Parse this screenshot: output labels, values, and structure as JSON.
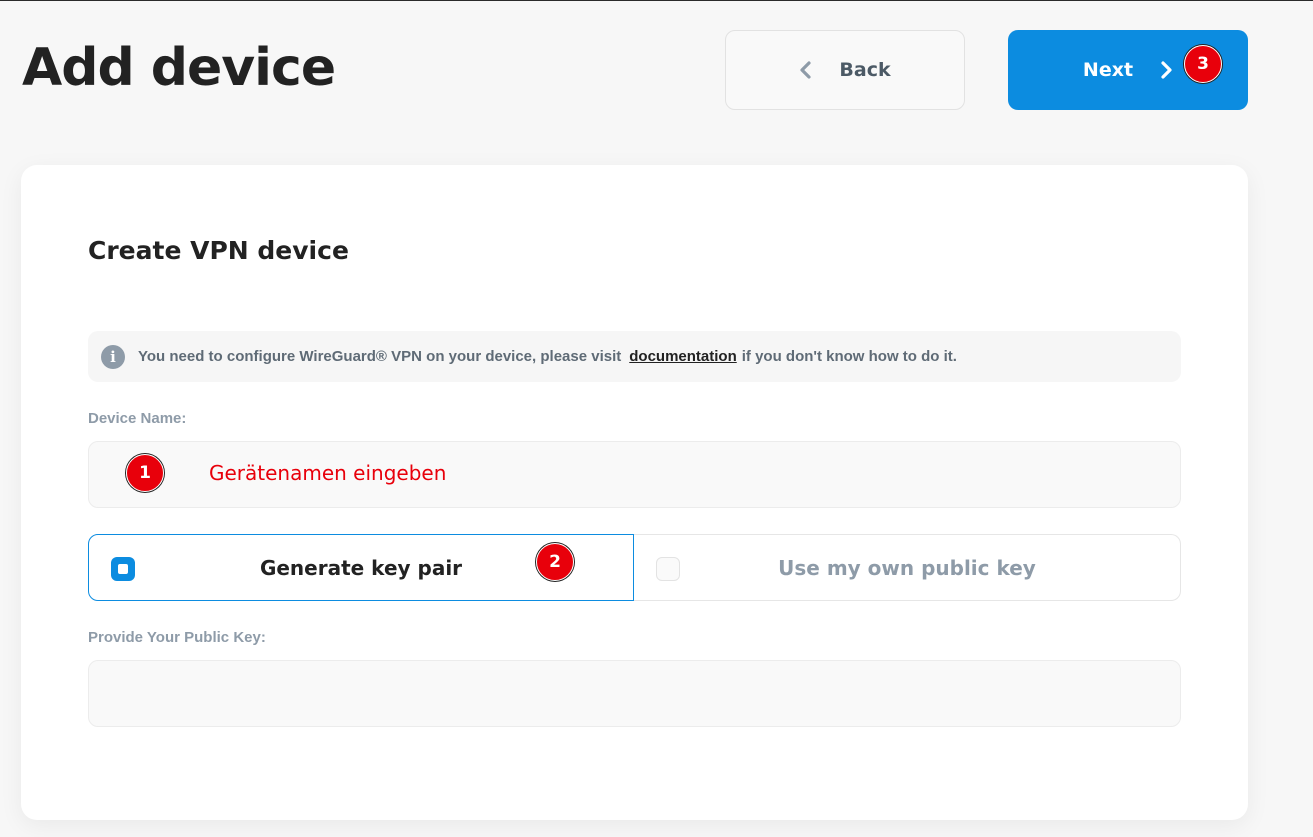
{
  "header": {
    "title": "Add device",
    "back_label": "Back",
    "next_label": "Next"
  },
  "card": {
    "title": "Create VPN device",
    "info": {
      "icon": "info-icon",
      "text_before": "You need to configure WireGuard® VPN on your device, please visit",
      "link": "documentation",
      "text_after": "if you don't know how to do it."
    },
    "device_name": {
      "label": "Device Name:",
      "value": ""
    },
    "key_mode": {
      "options": [
        "Generate key pair",
        "Use my own public key"
      ],
      "selected": "Generate key pair"
    },
    "public_key": {
      "label": "Provide Your Public Key:",
      "value": ""
    }
  },
  "annotations": {
    "marker_1": "1",
    "marker_2": "2",
    "marker_3": "3",
    "note_1": "Gerätenamen eingeben",
    "color": "#e8000b"
  },
  "colors": {
    "accent": "#0c8ce0",
    "background": "#f7f7f7"
  }
}
